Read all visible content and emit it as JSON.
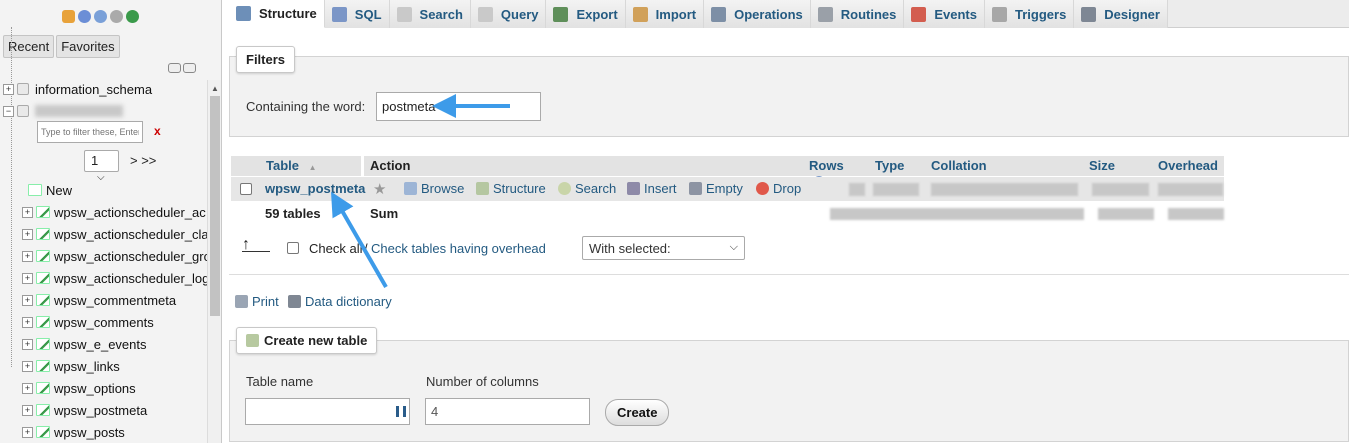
{
  "nav": {
    "tabs": [
      "Recent",
      "Favorites"
    ],
    "databases": [
      {
        "name": "information_schema"
      }
    ],
    "filter_placeholder": "Type to filter these, Enter",
    "filter_clear": "x",
    "page_select": "1",
    "page_next": "> >>",
    "new_label": "New",
    "tables": [
      "wpsw_actionscheduler_ac",
      "wpsw_actionscheduler_cla",
      "wpsw_actionscheduler_gro",
      "wpsw_actionscheduler_log",
      "wpsw_commentmeta",
      "wpsw_comments",
      "wpsw_e_events",
      "wpsw_links",
      "wpsw_options",
      "wpsw_postmeta",
      "wpsw_posts"
    ]
  },
  "tabs": [
    "Structure",
    "SQL",
    "Search",
    "Query",
    "Export",
    "Import",
    "Operations",
    "Routines",
    "Events",
    "Triggers",
    "Designer"
  ],
  "filters": {
    "legend": "Filters",
    "label": "Containing the word:",
    "value": "postmeta"
  },
  "table_list": {
    "headers": {
      "table": "Table",
      "sort_icon": "▲",
      "action": "Action",
      "rows": "Rows",
      "type": "Type",
      "collation": "Collation",
      "size": "Size",
      "overhead": "Overhead"
    },
    "row": {
      "name": "wpsw_postmeta",
      "actions": [
        "Browse",
        "Structure",
        "Search",
        "Insert",
        "Empty",
        "Drop"
      ]
    },
    "footer": {
      "count": "59 tables",
      "sum": "Sum"
    },
    "check_all": "Check all",
    "check_overhead": "Check tables having overhead",
    "with_selected": "With selected:"
  },
  "links": {
    "print": "Print",
    "data_dictionary": "Data dictionary"
  },
  "create_table": {
    "legend": "Create new table",
    "name_label": "Table name",
    "name_value": "",
    "columns_label": "Number of columns",
    "columns_value": "4",
    "button": "Create"
  },
  "colors": {
    "link": "#235a81",
    "annotation_arrow": "#3d9be9"
  }
}
